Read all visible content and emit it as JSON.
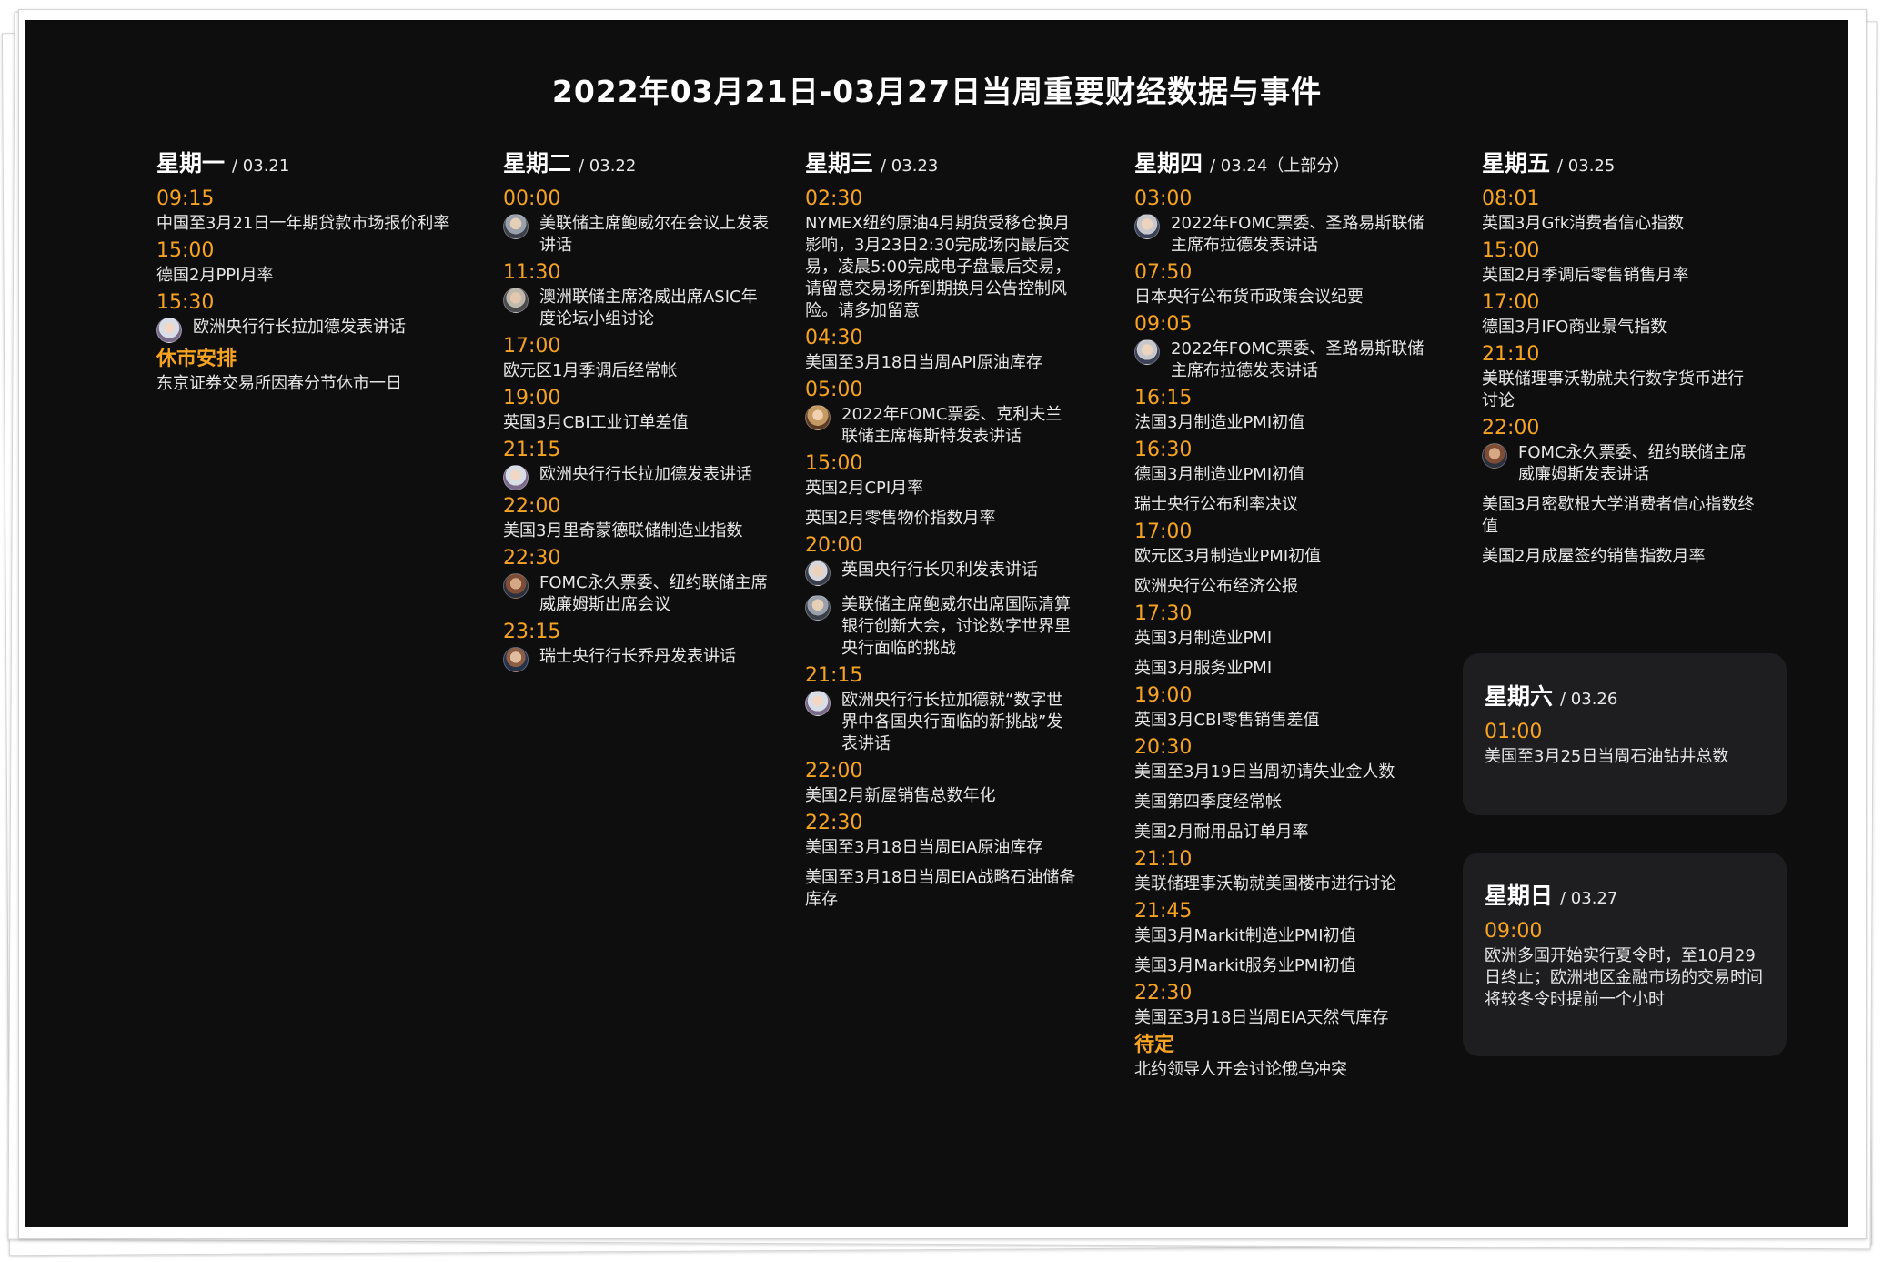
{
  "title": "2022年03月21日-03月27日当周重要财经数据与事件",
  "days": {
    "mon": {
      "name": "星期一",
      "date": "/ 03.21"
    },
    "tue": {
      "name": "星期二",
      "date": "/ 03.22"
    },
    "wed": {
      "name": "星期三",
      "date": "/ 03.23"
    },
    "thu": {
      "name": "星期四",
      "date": "/ 03.24（上部分）"
    },
    "fri": {
      "name": "星期五",
      "date": "/ 03.25"
    },
    "sat": {
      "name": "星期六",
      "date": "/ 03.26"
    },
    "sun": {
      "name": "星期日",
      "date": "/ 03.27"
    }
  },
  "mon": [
    {
      "time": "09:15",
      "text": "中国至3月21日一年期贷款市场报价利率"
    },
    {
      "time": "15:00",
      "text": "德国2月PPI月率"
    },
    {
      "time": "15:30",
      "text": "欧洲央行行长拉加德发表讲话",
      "icon": "lagarde-avatar"
    },
    {
      "time": "休市安排",
      "text": "东京证券交易所因春分节休市一日"
    }
  ],
  "tue": [
    {
      "time": "00:00",
      "text": "美联储主席鲍威尔在会议上发表讲话",
      "icon": "powell-avatar"
    },
    {
      "time": "11:30",
      "text": "澳洲联储主席洛威出席ASIC年度论坛小组讨论",
      "icon": "lowe-avatar"
    },
    {
      "time": "17:00",
      "text": "欧元区1月季调后经常帐"
    },
    {
      "time": "19:00",
      "text": "英国3月CBI工业订单差值"
    },
    {
      "time": "21:15",
      "text": "欧洲央行行长拉加德发表讲话",
      "icon": "lagarde-avatar"
    },
    {
      "time": "22:00",
      "text": "美国3月里奇蒙德联储制造业指数"
    },
    {
      "time": "22:30",
      "text": "FOMC永久票委、纽约联储主席威廉姆斯出席会议",
      "icon": "williams-avatar"
    },
    {
      "time": "23:15",
      "text": "瑞士央行行长乔丹发表讲话",
      "icon": "jordan-avatar"
    }
  ],
  "wed": [
    {
      "time": "02:30",
      "text": "NYMEX纽约原油4月期货受移仓换月影响，3月23日2:30完成场内最后交易，凌晨5:00完成电子盘最后交易，请留意交易场所到期换月公告控制风险。请多加留意"
    },
    {
      "time": "04:30",
      "text": "美国至3月18日当周API原油库存"
    },
    {
      "time": "05:00",
      "text": "2022年FOMC票委、克利夫兰联储主席梅斯特发表讲话",
      "icon": "mester-avatar"
    },
    {
      "time": "15:00",
      "text": "英国2月CPI月率",
      "text2": "英国2月零售物价指数月率"
    },
    {
      "time": "20:00",
      "text": "英国央行行长贝利发表讲话",
      "icon": "bailey-avatar",
      "text2": "美联储主席鲍威尔出席国际清算银行创新大会，讨论数字世界里央行面临的挑战",
      "icon2": "powell-avatar"
    },
    {
      "time": "21:15",
      "text": "欧洲央行行长拉加德就“数字世界中各国央行面临的新挑战”发表讲话",
      "icon": "lagarde-avatar"
    },
    {
      "time": "22:00",
      "text": "美国2月新屋销售总数年化"
    },
    {
      "time": "22:30",
      "text": "美国至3月18日当周EIA原油库存",
      "text2": "美国至3月18日当周EIA战略石油储备库存"
    }
  ],
  "thu": [
    {
      "time": "03:00",
      "text": "2022年FOMC票委、圣路易斯联储主席布拉德发表讲话",
      "icon": "bullard-avatar"
    },
    {
      "time": "07:50",
      "text": "日本央行公布货币政策会议纪要"
    },
    {
      "time": "09:05",
      "text": "2022年FOMC票委、圣路易斯联储主席布拉德发表讲话",
      "icon": "bullard-avatar"
    },
    {
      "time": "16:15",
      "text": "法国3月制造业PMI初值"
    },
    {
      "time": "16:30",
      "text": "德国3月制造业PMI初值",
      "text2": "瑞士央行公布利率决议"
    },
    {
      "time": "17:00",
      "text": "欧元区3月制造业PMI初值",
      "text2": "欧洲央行公布经济公报"
    },
    {
      "time": "17:30",
      "text": "英国3月制造业PMI",
      "text2": "英国3月服务业PMI"
    },
    {
      "time": "19:00",
      "text": "英国3月CBI零售销售差值"
    },
    {
      "time": "20:30",
      "text": "美国至3月19日当周初请失业金人数",
      "text2": "美国第四季度经常帐",
      "text3": "美国2月耐用品订单月率"
    },
    {
      "time": "21:10",
      "text": "美联储理事沃勒就美国楼市进行讨论"
    },
    {
      "time": "21:45",
      "text": "美国3月Markit制造业PMI初值",
      "text2": "美国3月Markit服务业PMI初值"
    },
    {
      "time": "22:30",
      "text": "美国至3月18日当周EIA天然气库存"
    },
    {
      "time": "待定",
      "text": "北约领导人开会讨论俄乌冲突"
    }
  ],
  "fri": [
    {
      "time": "08:01",
      "text": "英国3月Gfk消费者信心指数"
    },
    {
      "time": "15:00",
      "text": "英国2月季调后零售销售月率"
    },
    {
      "time": "17:00",
      "text": "德国3月IFO商业景气指数"
    },
    {
      "time": "21:10",
      "text": "美联储理事沃勒就央行数字货币进行讨论"
    },
    {
      "time": "22:00",
      "text": "FOMC永久票委、纽约联储主席威廉姆斯发表讲话",
      "icon": "williams-avatar",
      "text2": "美国3月密歇根大学消费者信心指数终值",
      "text3": "美国2月成屋签约销售指数月率"
    }
  ],
  "sat": [
    {
      "time": "01:00",
      "text": "美国至3月25日当周石油钻井总数"
    }
  ],
  "sun": [
    {
      "time": "09:00",
      "text": "欧洲多国开始实行夏令时，至10月29日终止；欧洲地区金融市场的交易时间将较冬令时提前一个小时"
    }
  ],
  "colors": {
    "background": "#0e0e0f",
    "time": "#f5a321",
    "text": "#e6e6e6",
    "card": "#1e1e20"
  }
}
